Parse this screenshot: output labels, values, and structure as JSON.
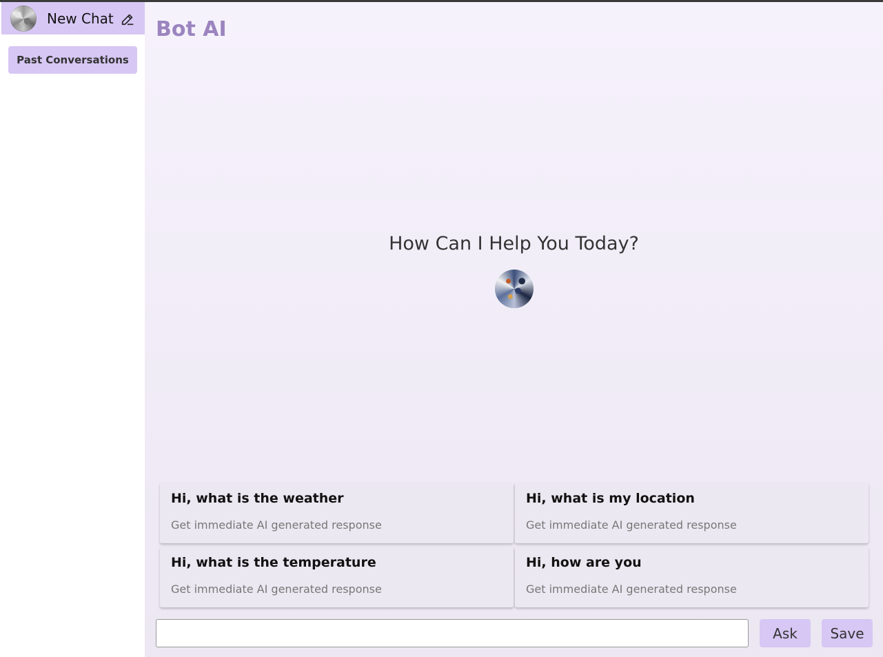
{
  "sidebar": {
    "new_chat_label": "New Chat",
    "past_conversations_label": "Past Conversations"
  },
  "main": {
    "brand": "Bot AI",
    "hero_text": "How Can I Help You Today?",
    "cards": [
      {
        "title": "Hi, what is the weather",
        "subtitle": "Get immediate AI generated response"
      },
      {
        "title": "Hi, what is my location",
        "subtitle": "Get immediate AI generated response"
      },
      {
        "title": "Hi, what is the temperature",
        "subtitle": "Get immediate AI generated response"
      },
      {
        "title": "Hi, how are you",
        "subtitle": "Get immediate AI generated response"
      }
    ],
    "input": {
      "value": "",
      "placeholder": ""
    },
    "ask_label": "Ask",
    "save_label": "Save"
  },
  "colors": {
    "accent": "#d7c7f4",
    "brand_text": "#9b84bf"
  },
  "icons": {
    "edit": "edit-icon",
    "avatar": "bot-avatar"
  }
}
